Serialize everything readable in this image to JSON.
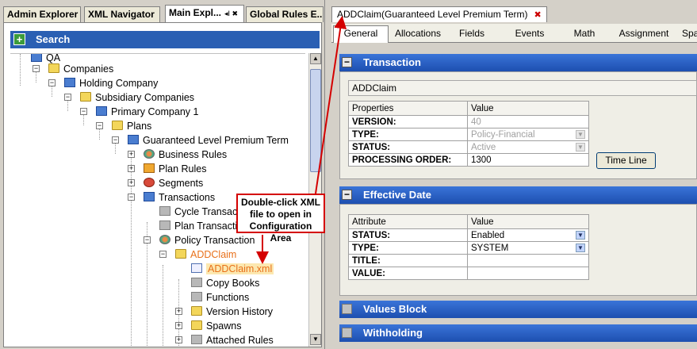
{
  "left_tabs": [
    {
      "label": "Admin Explorer"
    },
    {
      "label": "XML Navigator"
    },
    {
      "label": "Main Expl...",
      "pin": "◂I ✖"
    },
    {
      "label": "Global Rules E..."
    }
  ],
  "search": {
    "label": "Search",
    "plus": "+"
  },
  "tree": {
    "items": [
      {
        "label": "QA"
      },
      {
        "label": "Companies"
      },
      {
        "label": "Holding Company"
      },
      {
        "label": "Subsidiary Companies"
      },
      {
        "label": "Primary Company 1"
      },
      {
        "label": "Plans"
      },
      {
        "label": "Guaranteed Level Premium Term"
      },
      {
        "label": "Business Rules"
      },
      {
        "label": "Plan Rules"
      },
      {
        "label": "Segments"
      },
      {
        "label": "Transactions"
      },
      {
        "label": "Cycle Transactions"
      },
      {
        "label": "Plan Transactions"
      },
      {
        "label": "Policy Transaction"
      },
      {
        "label": "ADDClaim"
      },
      {
        "label": "ADDClaim.xml"
      },
      {
        "label": "Copy Books"
      },
      {
        "label": "Functions"
      },
      {
        "label": "Version History"
      },
      {
        "label": "Spawns"
      },
      {
        "label": "Attached Rules"
      }
    ]
  },
  "callout": {
    "text": "Double-click XML file to open in Configuration Area"
  },
  "doc_tab": {
    "label": "ADDClaim(Guaranteed Level Premium Term)",
    "close": "✖"
  },
  "sub_tabs": [
    {
      "label": "General"
    },
    {
      "label": "Allocations"
    },
    {
      "label": "Fields"
    },
    {
      "label": "Events"
    },
    {
      "label": "Math"
    },
    {
      "label": "Assignment"
    },
    {
      "label": "Spa"
    }
  ],
  "transaction": {
    "header": "Transaction",
    "name": "ADDClaim",
    "col_properties": "Properties",
    "col_value": "Value",
    "rows": [
      {
        "key": "VERSION:",
        "value": "40"
      },
      {
        "key": "TYPE:",
        "value": "Policy-Financial"
      },
      {
        "key": "STATUS:",
        "value": "Active"
      },
      {
        "key": "PROCESSING ORDER:",
        "value": "1300"
      }
    ],
    "timeline_button": "Time Line"
  },
  "effective_date": {
    "header": "Effective Date",
    "col_attribute": "Attribute",
    "col_value": "Value",
    "rows": [
      {
        "key": "STATUS:",
        "value": "Enabled"
      },
      {
        "key": "TYPE:",
        "value": "SYSTEM"
      },
      {
        "key": "TITLE:",
        "value": ""
      },
      {
        "key": "VALUE:",
        "value": ""
      }
    ]
  },
  "values_block": {
    "header": "Values Block"
  },
  "withholding": {
    "header": "Withholding"
  },
  "colors": {
    "section_blue": "#1d4fb0",
    "callout_red": "#d40000",
    "highlight_orange": "#e8701a"
  }
}
